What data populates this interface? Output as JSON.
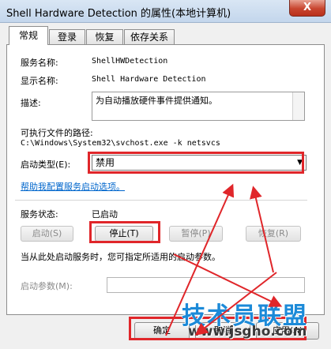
{
  "window": {
    "title": "Shell Hardware Detection 的属性(本地计算机)",
    "close_label": "X"
  },
  "tabs": [
    {
      "label": "常规",
      "active": true
    },
    {
      "label": "登录"
    },
    {
      "label": "恢复"
    },
    {
      "label": "依存关系"
    }
  ],
  "general": {
    "service_name_label": "服务名称:",
    "service_name_value": "ShellHWDetection",
    "display_name_label": "显示名称:",
    "display_name_value": "Shell Hardware Detection",
    "description_label": "描述:",
    "description_value": "为自动播放硬件事件提供通知。",
    "exec_path_label": "可执行文件的路径:",
    "exec_path_value": "C:\\Windows\\System32\\svchost.exe -k netsvcs",
    "startup_type_label": "启动类型(E):",
    "startup_type_value": "禁用",
    "help_link": "帮助我配置服务启动选项。",
    "status_label": "服务状态:",
    "status_value": "已启动",
    "buttons": {
      "start": "启动(S)",
      "stop": "停止(T)",
      "pause": "暂停(P)",
      "resume": "恢复(R)"
    },
    "hint_text": "当从此处启动服务时，您可指定所适用的启动参数。",
    "params_label": "启动参数(M):"
  },
  "footer": {
    "ok": "确定",
    "cancel": "取消",
    "apply": "应用(A)"
  },
  "watermark": {
    "main": "技术员联盟",
    "url": "www.jsgho.com"
  },
  "colors": {
    "highlight_red": "#e0262a",
    "link_blue": "#0066cc",
    "watermark_blue": "#1c8ad8"
  }
}
